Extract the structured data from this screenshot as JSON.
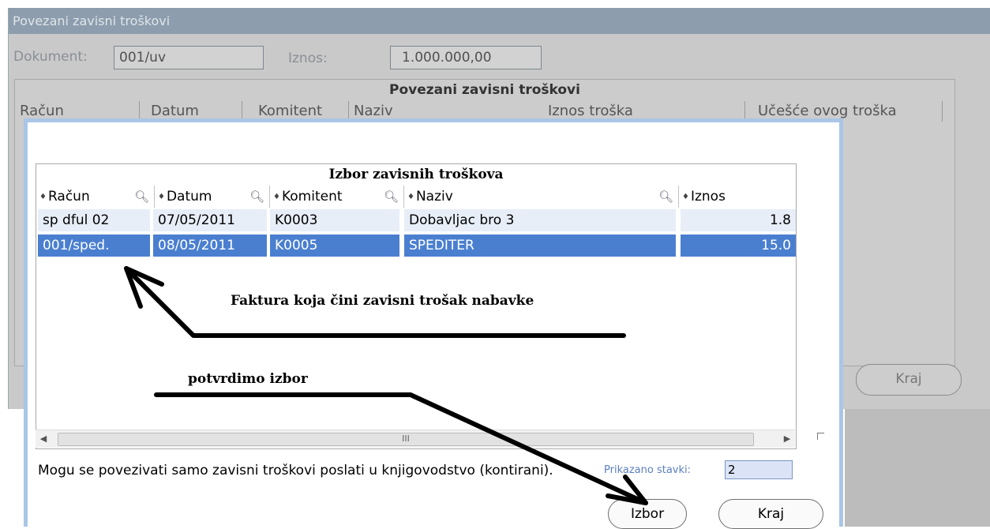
{
  "background_window": {
    "title": "Povezani zavisni troškovi",
    "dokument_label": "Dokument:",
    "dokument_value": "001/uv",
    "iznos_label": "Iznos:",
    "iznos_value": "1.000.000,00",
    "grid_title": "Povezani zavisni troškovi",
    "columns": [
      "Račun",
      "Datum",
      "Komitent",
      "Naziv",
      "Iznos troška",
      "Učešće ovog troška"
    ],
    "kraj_label": "Kraj"
  },
  "dialog": {
    "grid_title": "Izbor zavisnih troškova",
    "columns": [
      "Račun",
      "Datum",
      "Komitent",
      "Naziv",
      "Iznos"
    ],
    "rows": [
      {
        "racun": "sp dful 02",
        "datum": "07/05/2011",
        "komitent": "K0003",
        "naziv": "Dobavljac bro 3",
        "iznos": "1.8"
      },
      {
        "racun": "001/sped.",
        "datum": "08/05/2011",
        "komitent": "K0005",
        "naziv": "SPEDITER",
        "iznos": "15.0"
      }
    ],
    "scroll_grip": "III",
    "note": "Mogu se povezivati samo zavisni troškovi poslati u knjigovodstvo (kontirani).",
    "count_label": "Prikazano stavki:",
    "count_value": "2",
    "izbor_label": "Izbor",
    "kraj_label": "Kraj"
  },
  "annotations": {
    "arrow1_text": "Faktura koja čini zavisni trošak nabavke",
    "arrow2_text": "potvrdimo izbor"
  },
  "colors": {
    "selection": "#4a7fd0",
    "row_normal": "#e7eef8",
    "dialog_border": "#a9c6e6",
    "title_bar": "#8d9dad"
  },
  "icons": {
    "sort": "sort-arrows-icon",
    "filter": "magnifier-icon"
  }
}
